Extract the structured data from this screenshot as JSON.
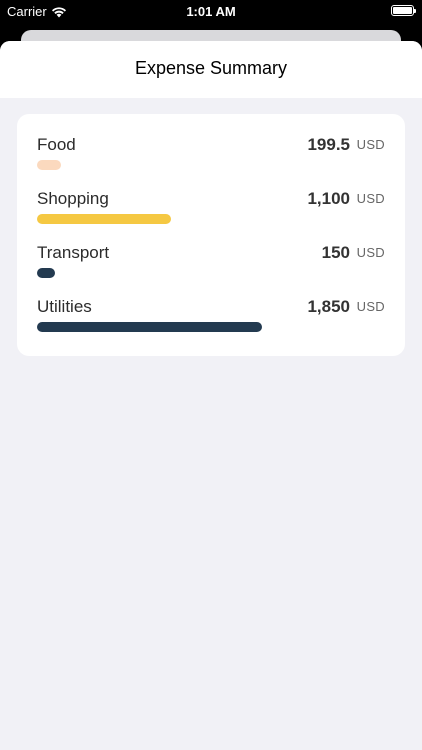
{
  "status_bar": {
    "carrier": "Carrier",
    "time": "1:01 AM",
    "battery_level": 1.0
  },
  "nav": {
    "title": "Expense Summary"
  },
  "expenses": [
    {
      "category": "Food",
      "amount": "199.5",
      "currency": "USD",
      "value": 199.5,
      "color": "#fbd9be"
    },
    {
      "category": "Shopping",
      "amount": "1,100",
      "currency": "USD",
      "value": 1100,
      "color": "#f5c842"
    },
    {
      "category": "Transport",
      "amount": "150",
      "currency": "USD",
      "value": 150,
      "color": "#233a50"
    },
    {
      "category": "Utilities",
      "amount": "1,850",
      "currency": "USD",
      "value": 1850,
      "color": "#233a50"
    }
  ]
}
